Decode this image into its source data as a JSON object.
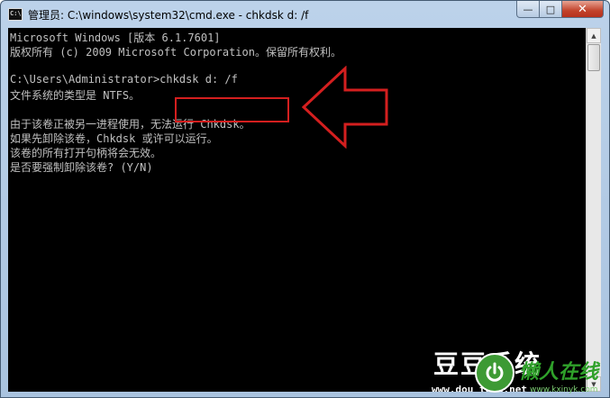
{
  "window": {
    "title": "管理员: C:\\windows\\system32\\cmd.exe - chkdsk  d: /f",
    "icon": "cmd-icon",
    "icon_text": "C:\\",
    "buttons": {
      "minimize": "—",
      "maximize": "□",
      "close": "✕"
    }
  },
  "console": {
    "lines": [
      "Microsoft Windows [版本 6.1.7601]",
      "版权所有 (c) 2009 Microsoft Corporation。保留所有权利。",
      "",
      "C:\\Users\\Administrator>chkdsk d: /f",
      "文件系统的类型是 NTFS。",
      "",
      "由于该卷正被另一进程使用，无法运行 Chkdsk。",
      "如果先卸除该卷，Chkdsk 或许可以运行。",
      "该卷的所有打开句柄将会无效。",
      "是否要强制卸除该卷? (Y/N)"
    ],
    "text_color": "#c0c0c0",
    "background": "#000000"
  },
  "scrollbar": {
    "up": "▲",
    "down": "▼"
  },
  "annotation": {
    "color": "#d41f1f"
  },
  "watermark": {
    "title": "豆豆系统",
    "url": "www.dou    tong.net",
    "logo_text": "懒人在线",
    "logo_url": "www.kxinyk.com"
  }
}
